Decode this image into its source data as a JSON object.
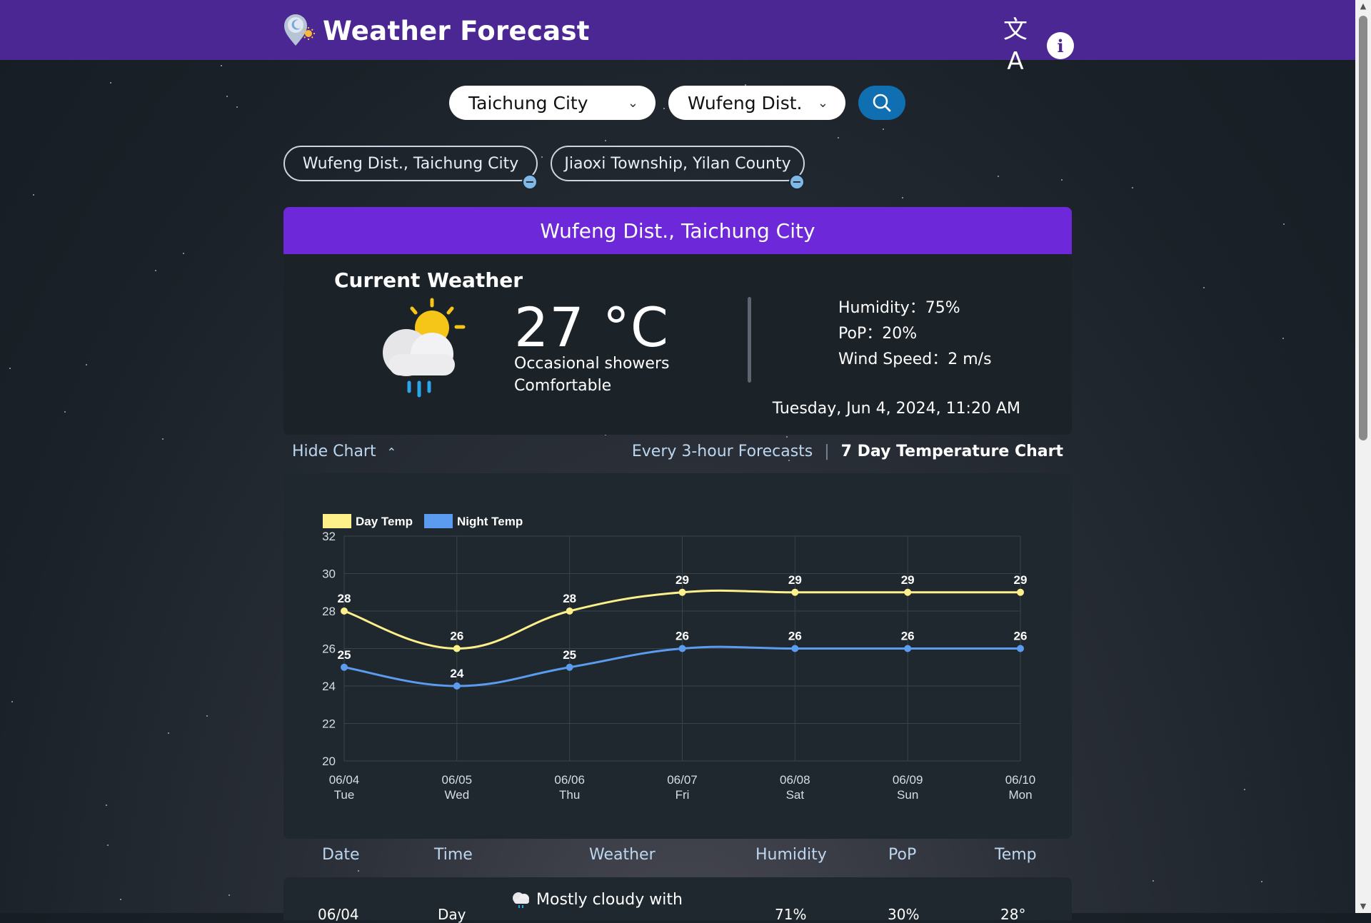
{
  "app": {
    "title": "Weather Forecast"
  },
  "header": {
    "translate_icon": "translate-icon",
    "info_icon": "info-icon"
  },
  "search": {
    "city": "Taichung City",
    "district": "Wufeng Dist.",
    "search_icon": "search-icon"
  },
  "saved_locations": [
    {
      "label": "Wufeng Dist., Taichung City"
    },
    {
      "label": "Jiaoxi Township, Yilan County"
    }
  ],
  "current": {
    "location": "Wufeng Dist., Taichung City",
    "section_title": "Current Weather",
    "temp": "27 °C",
    "description": "Occasional showers",
    "comfort": "Comfortable",
    "humidity": "Humidity：75%",
    "pop": "PoP：20%",
    "wind": "Wind Speed：2 m/s",
    "datetime": "Tuesday, Jun 4, 2024, 11:20 AM",
    "icon": "partly-cloudy-rain-icon"
  },
  "chart_controls": {
    "hide_label": "Hide Chart",
    "tab_hourly": "Every 3-hour Forecasts",
    "tab_weekly": "7 Day Temperature Chart"
  },
  "chart_data": {
    "type": "line",
    "categories": [
      "06/04 Tue",
      "06/05 Wed",
      "06/06 Thu",
      "06/07 Fri",
      "06/08 Sat",
      "06/09 Sun",
      "06/10 Mon"
    ],
    "category_dates": [
      "06/04",
      "06/05",
      "06/06",
      "06/07",
      "06/08",
      "06/09",
      "06/10"
    ],
    "category_days": [
      "Tue",
      "Wed",
      "Thu",
      "Fri",
      "Sat",
      "Sun",
      "Mon"
    ],
    "series": [
      {
        "name": "Day Temp",
        "values": [
          28,
          26,
          28,
          29,
          29,
          29,
          29
        ],
        "color": "#fdf08a"
      },
      {
        "name": "Night Temp",
        "values": [
          25,
          24,
          25,
          26,
          26,
          26,
          26
        ],
        "color": "#5b9cf0"
      }
    ],
    "ylim": [
      20,
      32
    ],
    "yticks": [
      20,
      22,
      24,
      26,
      28,
      30,
      32
    ],
    "grid": true,
    "legend": "top-left",
    "data_labels": true
  },
  "table": {
    "headers": [
      "Date",
      "Time",
      "Weather",
      "Humidity",
      "PoP",
      "Temp"
    ],
    "rows": [
      {
        "date": "06/04",
        "time": "Day",
        "weather": "Mostly cloudy with",
        "humidity": "71%",
        "pop": "30%",
        "temp": "28°",
        "icon": "cloud-rain-icon"
      }
    ]
  }
}
